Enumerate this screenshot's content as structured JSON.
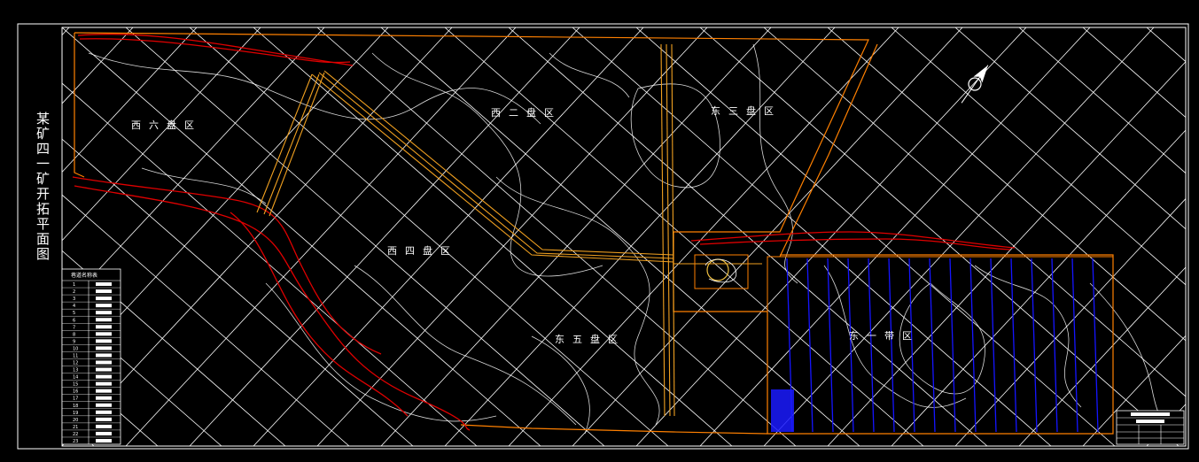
{
  "title": "某矿四一矿开拓平面图",
  "zones": [
    {
      "id": "xiliu",
      "label": "西六盘区"
    },
    {
      "id": "xier",
      "label": "西二盘区"
    },
    {
      "id": "dongsan",
      "label": "东三盘区"
    },
    {
      "id": "xisi",
      "label": "西四盘区"
    },
    {
      "id": "dongwu",
      "label": "东五盘区"
    },
    {
      "id": "dongyi",
      "label": "东一带区"
    }
  ],
  "legend_table": {
    "title": "巷道名称表",
    "row_numbers": [
      "1",
      "2",
      "3",
      "4",
      "5",
      "6",
      "7",
      "8",
      "9",
      "10",
      "11",
      "12",
      "13",
      "14",
      "15",
      "16",
      "17",
      "18",
      "19",
      "20",
      "21",
      "22",
      "23"
    ]
  },
  "colors": {
    "background": "#000000",
    "grid": "#ffffff",
    "roadway": "#f0a020",
    "boundary": "#ff8000",
    "fault": "#e00000",
    "workface": "#1515ff"
  }
}
